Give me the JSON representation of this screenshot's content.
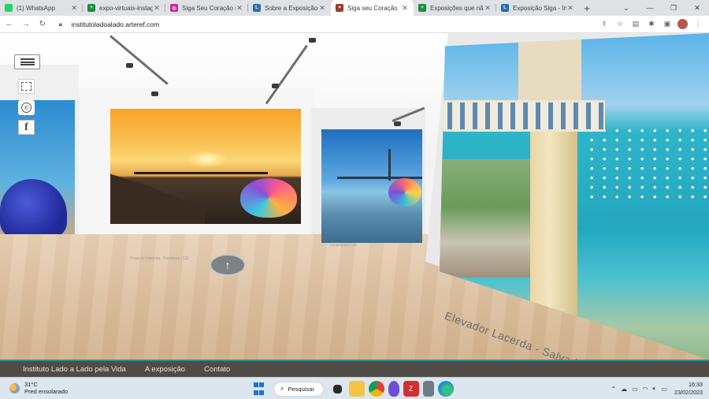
{
  "browser": {
    "tabs": [
      {
        "title": "(1) WhatsApp",
        "fav_color": "#25d366",
        "fav_glyph": "1",
        "active": false
      },
      {
        "title": "expo-virtuais-instagra",
        "fav_color": "#1e8e3e",
        "fav_glyph": "+",
        "active": false
      },
      {
        "title": "Siga Seu Coração no",
        "fav_color": "#d6249f",
        "fav_glyph": "◎",
        "active": false
      },
      {
        "title": "Sobre a Exposição Sig",
        "fav_color": "#2b6cb0",
        "fav_glyph": "L",
        "active": false
      },
      {
        "title": "Siga seu Coração",
        "fav_color": "#9b3b2a",
        "fav_glyph": "♥",
        "active": true
      },
      {
        "title": "Exposições que não p",
        "fav_color": "#1e8e3e",
        "fav_glyph": "+",
        "active": false
      },
      {
        "title": "Exposição Siga - Insti",
        "fav_color": "#2b6cb0",
        "fav_glyph": "L",
        "active": false
      }
    ],
    "url": "institutoladoalado.arteref.com"
  },
  "gallery": {
    "captions": {
      "sunset": "Praia de Iracema - Fortaleza / CE",
      "bridge": "Florianópolis / SC",
      "elevador": "Elevador Lacerda - Salvador / BA"
    }
  },
  "site_nav": {
    "items": [
      "Instituto Lado a Lado pela Vida",
      "A exposição",
      "Contato"
    ]
  },
  "taskbar": {
    "weather_temp": "31°C",
    "weather_desc": "Pred ensolarado",
    "search_label": "Pesquisar",
    "time": "16:33",
    "date": "23/02/2023"
  }
}
